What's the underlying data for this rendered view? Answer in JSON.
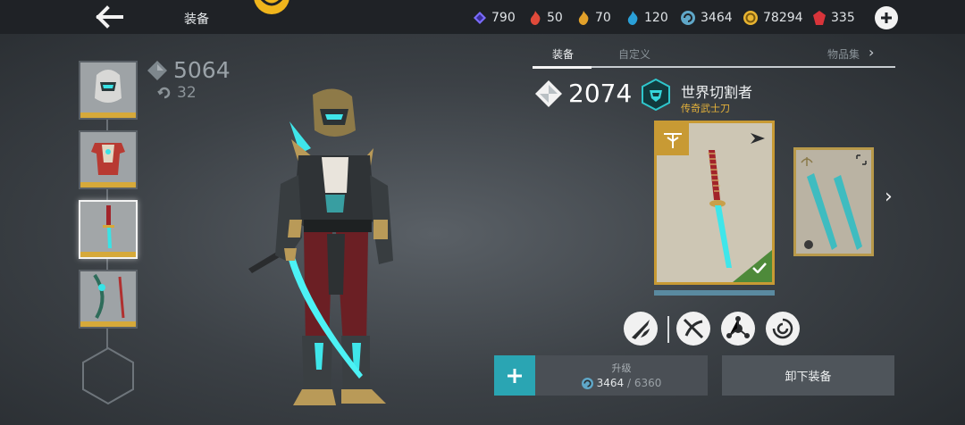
{
  "header": {
    "title": "装备",
    "back_icon": "arrow-left-icon"
  },
  "currencies": [
    {
      "icon": "purple-gem-icon",
      "color": "#7b6cff",
      "value": "790"
    },
    {
      "icon": "red-flame-icon",
      "color": "#e04a3a",
      "value": "50"
    },
    {
      "icon": "gold-flame-icon",
      "color": "#e2a12a",
      "value": "70"
    },
    {
      "icon": "blue-flame-icon",
      "color": "#2aa0d8",
      "value": "120"
    },
    {
      "icon": "swirl-orb-icon",
      "color": "#5fa7c8",
      "value": "3464"
    },
    {
      "icon": "gold-coin-icon",
      "color": "#e9b430",
      "value": "78294"
    },
    {
      "icon": "ruby-icon",
      "color": "#d8343a",
      "value": "335"
    }
  ],
  "character": {
    "total_power": "5064",
    "level": "32"
  },
  "slots": [
    {
      "name": "helmet-slot",
      "selected": false
    },
    {
      "name": "armor-slot",
      "selected": false
    },
    {
      "name": "weapon-slot",
      "selected": true
    },
    {
      "name": "ranged-slot",
      "selected": false
    }
  ],
  "tabs": {
    "equip": "装备",
    "custom": "自定义",
    "collection": "物品集"
  },
  "item": {
    "power": "2074",
    "name": "世界切割者",
    "rarity": "传奇武士刀"
  },
  "upgrade": {
    "label": "升级",
    "current": "3464",
    "separator": " / ",
    "required": "6360"
  },
  "unequip": {
    "label": "卸下装备"
  },
  "colors": {
    "accent": "#2aa5b3",
    "legendary": "#c89a34",
    "rarity_text": "#e5b23a"
  }
}
